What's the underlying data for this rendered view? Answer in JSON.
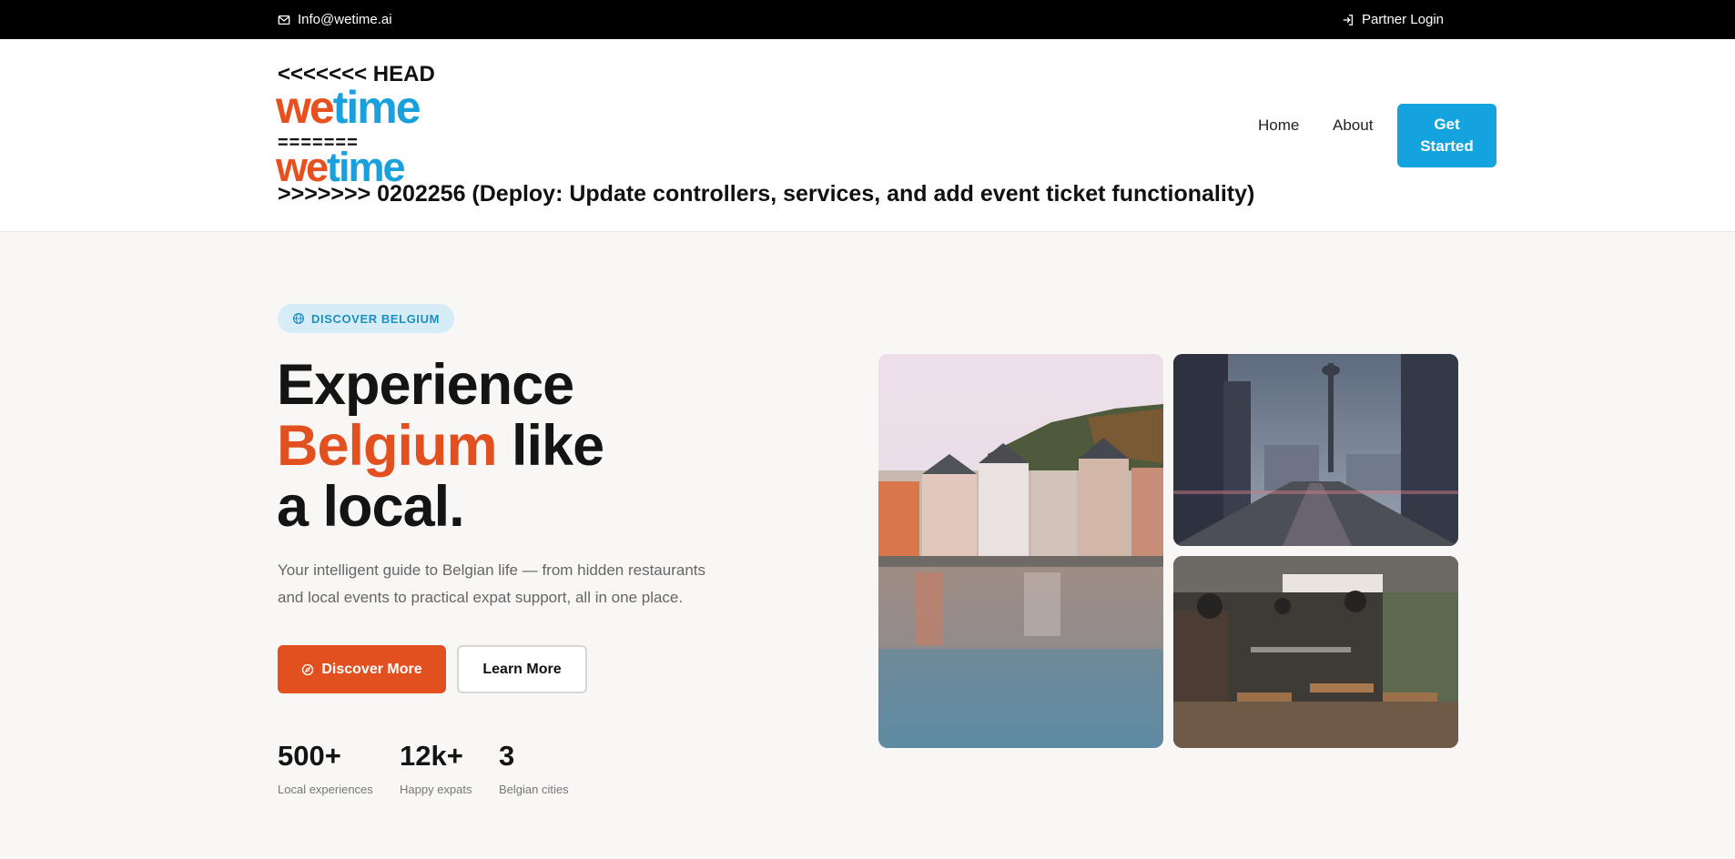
{
  "topbar": {
    "email": "Info@wetime.ai",
    "partner_login": "Partner Login",
    "email_icon": "mail-icon",
    "login_icon": "login-icon"
  },
  "header": {
    "conflict_head": "<<<<<<< HEAD",
    "conflict_separator": "=======",
    "conflict_tail": ">>>>>>> 0202256 (Deploy: Update controllers, services, and add event ticket functionality)",
    "logo_we": "we",
    "logo_time": "time",
    "nav": [
      "Home",
      "About"
    ],
    "get_started": "Get Started"
  },
  "hero": {
    "badge": "DISCOVER BELGIUM",
    "badge_icon": "globe-icon",
    "headline_1": "Experience",
    "headline_accent": "Belgium",
    "headline_2": " like",
    "headline_3": "a local.",
    "subtitle": "Your intelligent guide to Belgian life — from hidden restaurants and local events to practical expat support, all in one place.",
    "discover_button": "Discover More",
    "discover_icon": "compass-icon",
    "learn_button": "Learn More",
    "stats": [
      {
        "value": "500+",
        "label": "Local experiences"
      },
      {
        "value": "12k+",
        "label": "Happy expats"
      },
      {
        "value": "3",
        "label": "Belgian cities"
      }
    ]
  },
  "colors": {
    "accent_orange": "#e2501f",
    "accent_blue": "#13a3df",
    "background": "#f8f7f6"
  }
}
